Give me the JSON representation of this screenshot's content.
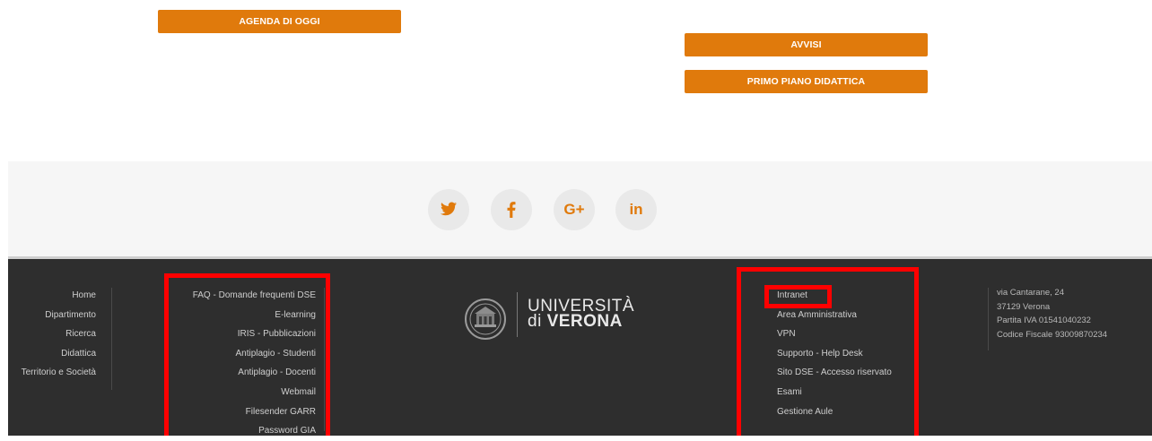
{
  "buttons": {
    "agenda": "AGENDA DI OGGI",
    "avvisi": "AVVISI",
    "primo_piano": "PRIMO PIANO DIDATTICA"
  },
  "social": {
    "twitter": "twitter-icon",
    "facebook": "facebook-icon",
    "googleplus_label": "G+",
    "linkedin_label": "in"
  },
  "footer": {
    "nav": [
      "Home",
      "Dipartimento",
      "Ricerca",
      "Didattica",
      "Territorio e Società"
    ],
    "services": [
      "FAQ - Domande frequenti DSE",
      "E-learning",
      "IRIS - Pubblicazioni",
      "Antiplagio - Studenti",
      "Antiplagio - Docenti",
      "Webmail",
      "Filesender GARR",
      "Password GIA"
    ],
    "intranet": [
      "Intranet",
      "Area Amministrativa",
      "VPN",
      "Supporto - Help Desk",
      "Sito DSE - Accesso riservato",
      "Esami",
      "Gestione Aule"
    ],
    "address": [
      "via Cantarane, 24",
      "37129 Verona",
      "Partita IVA 01541040232",
      "Codice Fiscale 93009870234"
    ],
    "logo": {
      "line1": "UNIVERSITÀ",
      "line2_prefix": "di ",
      "line2_bold": "VERONA"
    }
  },
  "colors": {
    "accent": "#e07a0c",
    "footer_bg": "#2e2e2e",
    "highlight": "#ff0000"
  }
}
